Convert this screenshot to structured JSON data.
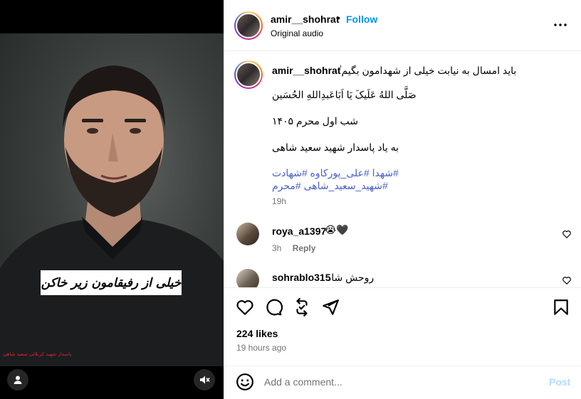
{
  "header": {
    "username": "amir__shohrat",
    "separator": "•",
    "follow_label": "Follow",
    "audio_label": "Original audio",
    "more_icon": "more-horizontal-icon"
  },
  "media": {
    "overlay_caption": "خیلی از رفیقامون زیر خاکن",
    "corner_text": "پاسدار شهید کربلائی سعید شاهی",
    "user_icon": "user-tag-icon",
    "mute_icon": "muted-speaker-icon"
  },
  "post": {
    "username": "amir__shohrat",
    "caption_line1": "باید امسال به نیابت خیلی از شهدامون بگیم ٰ",
    "caption_line2": "صَلَّی اللهُ عَلَیکَ یَا اَبَاعَبدِاللهِ الحُسَین",
    "caption_line3": "شب اول محرم ۱۴۰۵",
    "caption_line4": "به یاد پاسدار شهید سعید شاهی",
    "hashtags_line1": "#شهدا #علی_پورکاوه #شهادت",
    "hashtags_line2": "#شهید_سعید_شاهی #محرم",
    "time": "19h"
  },
  "comments": [
    {
      "username": "roya_a1397",
      "text": "😭🖤",
      "time": "3h",
      "reply_label": "Reply"
    },
    {
      "username": "sohrablo315",
      "text": "روحش شاد"
    }
  ],
  "actions": {
    "icons": [
      "heart-icon",
      "comment-icon",
      "repost-icon",
      "send-icon",
      "bookmark-icon"
    ],
    "likes": "224 likes",
    "posted_ago": "19 hours ago"
  },
  "add_comment": {
    "placeholder": "Add a comment...",
    "post_label": "Post",
    "emoji_icon": "emoji-icon"
  },
  "colors": {
    "link": "#0095f6",
    "hashtag": "#4a5fc7",
    "muted": "#737373",
    "post_disabled": "#b3dbff"
  }
}
